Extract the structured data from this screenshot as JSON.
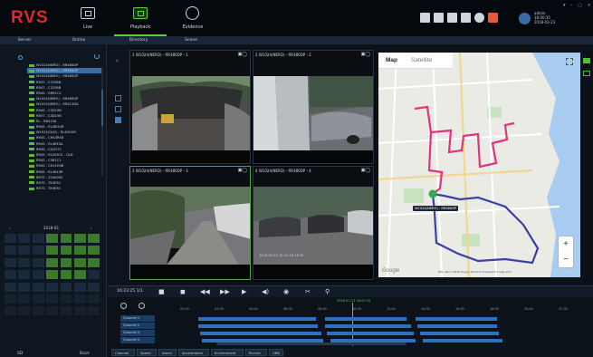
{
  "app": {
    "logo": "RVS"
  },
  "nav": {
    "tabs": [
      {
        "label": "Live"
      },
      {
        "label": "Playback"
      },
      {
        "label": "Evidence"
      }
    ]
  },
  "user": {
    "name": "admin",
    "time": "18:00:35",
    "date": "2018-03-23"
  },
  "subtabs": [
    "Server",
    "Online",
    "Directory",
    "Scene"
  ],
  "devices": [
    "W1024(NERO) - RR480DP",
    "W1024(NERO) - RR480DP",
    "W1024(NERO) - RR480DP",
    "RR4T - C3708B",
    "RR4T - C3708B",
    "RR4S - RRR1C2",
    "W1024(NERO) - RR480DP",
    "W1024(NERO) - RR4C3DA",
    "RR4S - C3D19B",
    "RR5T - C3D19B",
    "RL - RR470A",
    "RR4S - RL4ROUR",
    "W1024(OLD) - RL4ROUR",
    "RR4S - CH43R4B",
    "RR4S - RL4R43A",
    "RR4S - CJ102T1",
    "RR4S - RL003C0 - OLD",
    "RR4S - C3B7C1",
    "RR4S - CH21H4B",
    "RR4S - RL4R43R",
    "RR7S - 2S4A0S0",
    "RR7S - TK4E50",
    "RR7S - TK4E50"
  ],
  "calendar": {
    "header": "2018-03",
    "footer_left": "SD",
    "footer_right": "Back"
  },
  "video": {
    "panes": [
      {
        "title": "1 W1024(NERO) - RR480DP - 1"
      },
      {
        "title": "2 W1024(NERO) - RR480DP - 2"
      },
      {
        "title": "3 W1024(NERO) - RR480DP - 3"
      },
      {
        "title": "4 W1024(NERO) - RR480DP - 4"
      }
    ],
    "osd": "2018-03-23 12:41:18  18   55"
  },
  "map": {
    "tabs": [
      "Map",
      "Satellite"
    ],
    "vehicle_label": "W1024(NERO) - RR480DP",
    "watermark": "Google",
    "footer": "Map data ©2018 Google   Terms of Use   Report a map error",
    "zoom_in": "+",
    "zoom_out": "−"
  },
  "playback": {
    "speed": "16:23:25  1/1",
    "controls": [
      "■",
      "◼",
      "◀◀",
      "▶▶",
      "▶",
      "◀)",
      "◉",
      "✂",
      "⚲"
    ]
  },
  "timeline": {
    "current": "2018-03-23 18:00:35",
    "ticks": [
      "00:00",
      "02:00",
      "04:00",
      "06:00",
      "08:00",
      "10:00",
      "12:00",
      "14:00",
      "16:00",
      "18:00",
      "20:00",
      "22:00"
    ],
    "channels": [
      "Channel 1",
      "Channel 2",
      "Channel 3",
      "Channel 4"
    ]
  },
  "bottom_tabs": [
    "Channel",
    "Speed",
    "Alarm",
    "Acceleration",
    "Environment",
    "Picture",
    "OBD"
  ]
}
